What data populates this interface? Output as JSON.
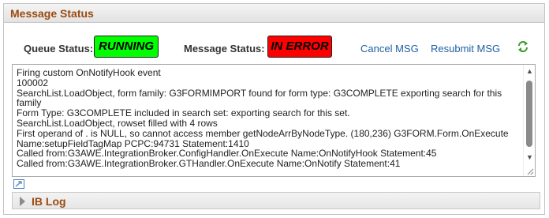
{
  "panel": {
    "title": "Message Status"
  },
  "status": {
    "queue_label": "Queue Status:",
    "queue_value": "RUNNING",
    "message_label": "Message Status:",
    "message_value": "IN ERROR",
    "queue_color": "#00ff00",
    "message_color": "#ff0000"
  },
  "actions": {
    "cancel": "Cancel MSG",
    "resubmit": "Resubmit MSG",
    "refresh_icon": "refresh-icon"
  },
  "log": {
    "lines": [
      "Firing custom OnNotifyHook event",
      "100002",
      "SearchList.LoadObject, form family: G3FORMIMPORT found for form type: G3COMPLETE exporting search for this family",
      "Form Type: G3COMPLETE included in search set:  exporting search for this set.",
      "SearchList.LoadObject, rowset filled with 4 rows",
      "First operand of . is NULL, so cannot access member getNodeArrByNodeType. (180,236) G3FORM.Form.OnExecute Name:setupFieldTagMap  PCPC:94731  Statement:1410",
      "Called from:G3AWE.IntegrationBroker.ConfigHandler.OnExecute  Name:OnNotifyHook  Statement:45",
      "Called from:G3AWE.IntegrationBroker.GTHandler.OnExecute  Name:OnNotify  Statement:41"
    ]
  },
  "ib_log": {
    "title": "IB Log"
  }
}
